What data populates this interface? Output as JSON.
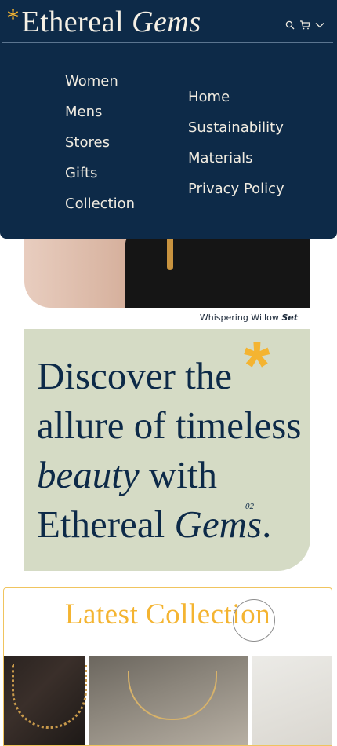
{
  "header": {
    "logo_star": "*",
    "logo_word": "Ethereal",
    "logo_italic": "Gems",
    "icons": [
      "search-icon",
      "cart-icon",
      "chevron-down-icon"
    ]
  },
  "menu": {
    "left": [
      "Women",
      "Mens",
      "Stores",
      "Gifts",
      "Collection"
    ],
    "right": [
      "Home",
      "Sustainability",
      "Materials",
      "Privacy Policy"
    ]
  },
  "hero": {
    "caption_text": "Whispering Willow",
    "caption_bold": "Set"
  },
  "discover": {
    "line1": "Discover the",
    "line2": "allure of timeless",
    "line3_italic": "beauty",
    "line3_rest": " with",
    "line4_word": "Ethereal",
    "line4_italic": "Gems",
    "line4_end": ".",
    "star": "*",
    "number": "02"
  },
  "latest": {
    "title": "Latest Collection"
  },
  "colors": {
    "navy": "#0d2a48",
    "gold": "#f4b431",
    "sage": "#d5dbc5"
  }
}
